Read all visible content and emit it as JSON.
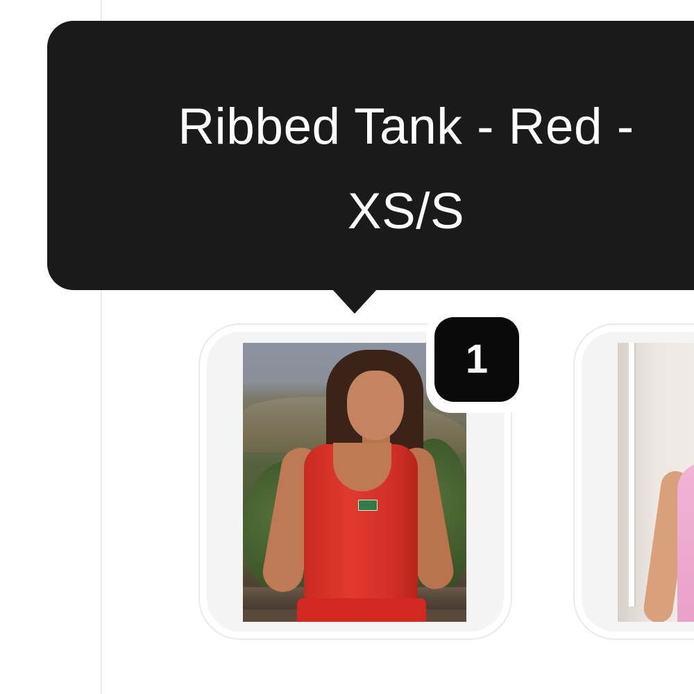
{
  "tooltip": {
    "line1": "Ribbed Tank - Red -",
    "line2": "XS/S"
  },
  "products": [
    {
      "image_alt": "Ribbed Tank - Red - XS/S",
      "badge": "1"
    },
    {
      "image_alt": ""
    }
  ],
  "colors": {
    "tooltip_bg": "#1a1a1a",
    "tooltip_text": "#ffffff",
    "badge_bg": "#0a0a0a",
    "card_bg": "#f4f4f4",
    "product_red": "#d4302a"
  },
  "icons": {
    "tooltip_pointer": "triangle-down"
  }
}
